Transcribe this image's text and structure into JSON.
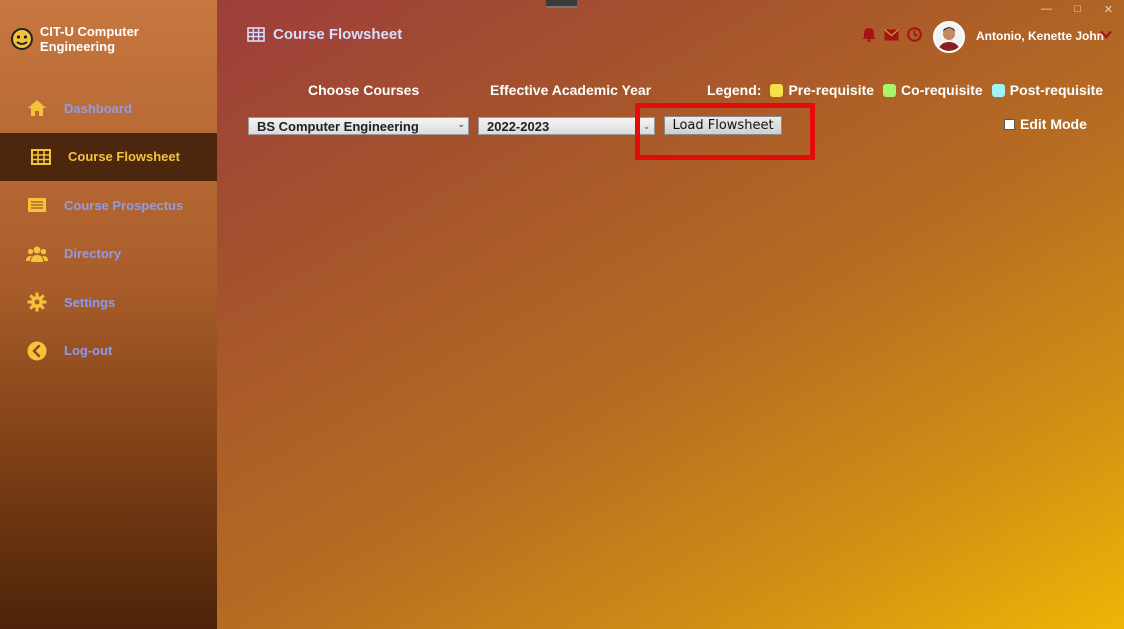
{
  "app": {
    "brand": "CIT-U Computer Engineering"
  },
  "sidebar": {
    "items": [
      {
        "label": "Dashboard",
        "icon": "home-icon"
      },
      {
        "label": "Course Flowsheet",
        "icon": "table-icon",
        "active": true
      },
      {
        "label": "Course Prospectus",
        "icon": "list-icon"
      },
      {
        "label": "Directory",
        "icon": "users-icon"
      },
      {
        "label": "Settings",
        "icon": "gear-icon"
      },
      {
        "label": "Log-out",
        "icon": "back-arrow-icon"
      }
    ]
  },
  "header": {
    "title": "Course Flowsheet",
    "user_name": "Antonio, Kenette John",
    "icons": [
      "bell-icon",
      "mail-icon",
      "clock-icon"
    ]
  },
  "controls": {
    "courses_label": "Choose Courses",
    "year_label": "Effective Academic Year",
    "course_value": "BS Computer Engineering",
    "year_value": "2022-2023",
    "load_button": "Load Flowsheet",
    "edit_mode": "Edit Mode"
  },
  "legend": {
    "title": "Legend:",
    "items": [
      {
        "label": "Pre-requisite",
        "color": "#f5e04a"
      },
      {
        "label": "Co-requisite",
        "color": "#a6f56a"
      },
      {
        "label": "Post-requisite",
        "color": "#9ff2f5"
      }
    ]
  },
  "colors": {
    "accent": "#f5c23a",
    "nav_text": "#8f9be8",
    "highlight": "#e60b0b"
  }
}
